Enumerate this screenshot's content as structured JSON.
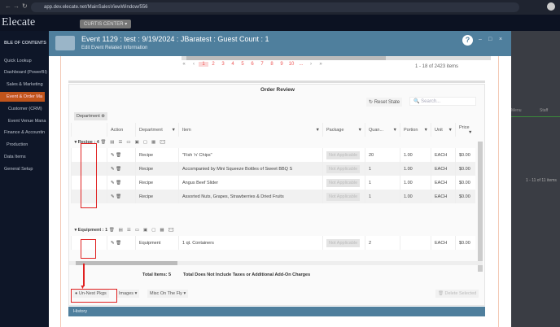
{
  "browser": {
    "url": "app.dev.elecate.net/MainSalesViewWindow/556"
  },
  "app": {
    "logo": "Elecate",
    "venue": "CURTIS CENTER"
  },
  "sidebar": {
    "header": "BLE OF CONTENTS",
    "items": [
      "Quick Lookup",
      "Dashboard (PowerBI)",
      "Sales & Marketing",
      "Event & Order Ma",
      "Customer (CRM)",
      "Event Venue Mana",
      "Finance & Accountin",
      "Production",
      "Data Items",
      "General Setup"
    ],
    "active": 3
  },
  "modal": {
    "title": "Event 1129 : test : 9/19/2024 : JBaratest : Guest Count : 1",
    "subtitle": "Edit Event Related Information",
    "help": "?",
    "pager": {
      "pages": [
        "1",
        "2",
        "3",
        "4",
        "5",
        "6",
        "7",
        "8",
        "9",
        "10",
        "..."
      ],
      "current": "1",
      "summary": "1 - 18 of 2423 items"
    }
  },
  "order_review": {
    "title": "Order Review",
    "reset_label": "Reset State",
    "search_placeholder": "Search...",
    "group_chip": "Department",
    "columns": [
      "Action",
      "Department",
      "Item",
      "Package",
      "Quan...",
      "Portion",
      "Unit",
      "Price"
    ],
    "groups": [
      {
        "label": "Recipe : 4",
        "rows": [
          {
            "department": "Recipe",
            "item": "\"Fish 'n' Chips\"",
            "package": "Not Applicable",
            "quantity": "20",
            "portion": "1.00",
            "unit": "EACH",
            "price": "$0.00"
          },
          {
            "department": "Recipe",
            "item": "Accompanied by Mini Squeeze Bottles of Sweet BBQ S",
            "package": "Not Applicable",
            "quantity": "1",
            "portion": "1.00",
            "unit": "EACH",
            "price": "$0.00"
          },
          {
            "department": "Recipe",
            "item": "Angus Beef Slider",
            "package": "Not Applicable",
            "quantity": "1",
            "portion": "1.00",
            "unit": "EACH",
            "price": "$0.00"
          },
          {
            "department": "Recipe",
            "item": "Assorted Nuts, Grapes, Strawberries & Dried Fruits",
            "package": "Not Applicable",
            "quantity": "1",
            "portion": "1.00",
            "unit": "EACH",
            "price": "$0.00"
          }
        ]
      },
      {
        "label": "Equipment : 1",
        "rows": [
          {
            "department": "Equipment",
            "item": "1 qt. Containers",
            "package": "Not Applicable",
            "quantity": "2",
            "portion": "",
            "unit": "EACH",
            "price": "$0.00"
          }
        ]
      }
    ],
    "total_items": "Total Items: 5",
    "total_note": "Total Does Not Include Taxes or Additional Add-On Charges",
    "toolbar": {
      "unnest": "Un-Nest Pkgs",
      "images": "Images",
      "misc": "Misc On The Fly",
      "delete": "Delete Selected"
    }
  },
  "history": "History",
  "right_bg": {
    "col1": "Menu",
    "col2": "Staff",
    "summary": "1 - 11 of 11 items"
  }
}
